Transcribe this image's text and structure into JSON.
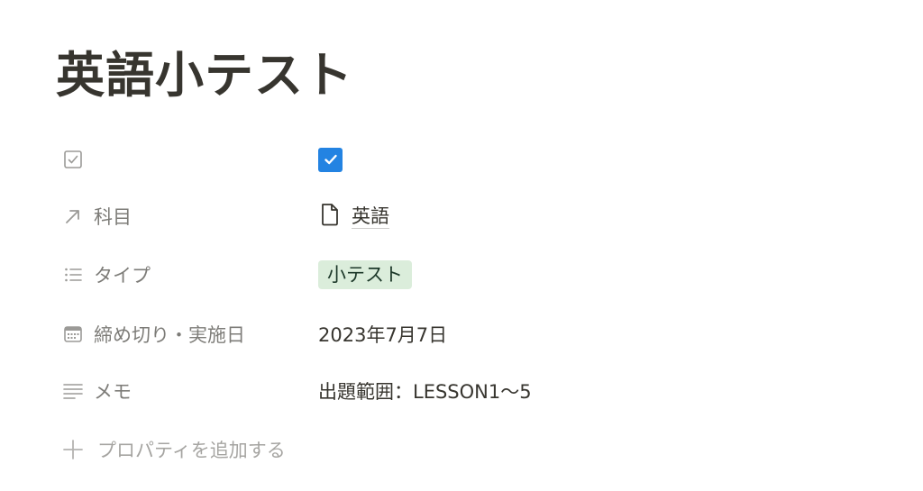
{
  "page": {
    "title": "英語小テスト"
  },
  "properties": [
    {
      "icon": "checkbox-icon",
      "name": "",
      "type": "checkbox",
      "checked": true
    },
    {
      "icon": "relation-arrow-icon",
      "name": "科目",
      "type": "relation",
      "value_icon": "document-icon",
      "value": "英語"
    },
    {
      "icon": "list-icon",
      "name": "タイプ",
      "type": "select",
      "value": "小テスト",
      "tag_color": "#dbeddb"
    },
    {
      "icon": "calendar-icon",
      "name": "締め切り・実施日",
      "type": "date",
      "value": "2023年7月7日"
    },
    {
      "icon": "text-lines-icon",
      "name": "メモ",
      "type": "text",
      "value": "出題範囲：LESSON1〜5"
    }
  ],
  "add_property": {
    "icon": "plus-icon",
    "label": "プロパティを追加する"
  },
  "colors": {
    "text": "#37352f",
    "checkbox_accent": "#2383e2",
    "tag_green": "#dbeddb"
  }
}
